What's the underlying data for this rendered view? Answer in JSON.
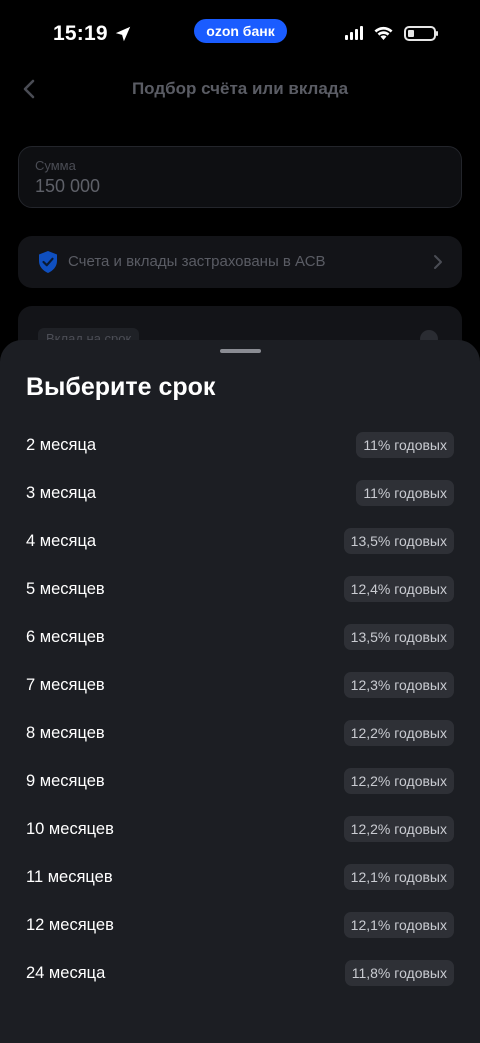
{
  "status_bar": {
    "time": "15:19",
    "brand": "ozon банк",
    "brand_color": "#1a5cff",
    "icons": [
      "location-arrow-icon",
      "cellular-signal-icon",
      "wifi-icon",
      "battery-icon"
    ]
  },
  "page": {
    "title": "Подбор счёта или вклада",
    "amount_label": "Сумма",
    "amount_value": "150 000",
    "insurance_text": "Счета и вклады застрахованы в АСВ",
    "deposit_chip": "Вклад на срок"
  },
  "sheet": {
    "title": "Выберите срок",
    "terms": [
      {
        "label": "2 месяца",
        "rate": "11% годовых"
      },
      {
        "label": "3 месяца",
        "rate": "11% годовых"
      },
      {
        "label": "4 месяца",
        "rate": "13,5% годовых"
      },
      {
        "label": "5 месяцев",
        "rate": "12,4% годовых"
      },
      {
        "label": "6 месяцев",
        "rate": "13,5% годовых"
      },
      {
        "label": "7 месяцев",
        "rate": "12,3% годовых"
      },
      {
        "label": "8 месяцев",
        "rate": "12,2% годовых"
      },
      {
        "label": "9 месяцев",
        "rate": "12,2% годовых"
      },
      {
        "label": "10 месяцев",
        "rate": "12,2% годовых"
      },
      {
        "label": "11 месяцев",
        "rate": "12,1% годовых"
      },
      {
        "label": "12 месяцев",
        "rate": "12,1% годовых"
      },
      {
        "label": "24 месяца",
        "rate": "11,8% годовых"
      }
    ]
  }
}
